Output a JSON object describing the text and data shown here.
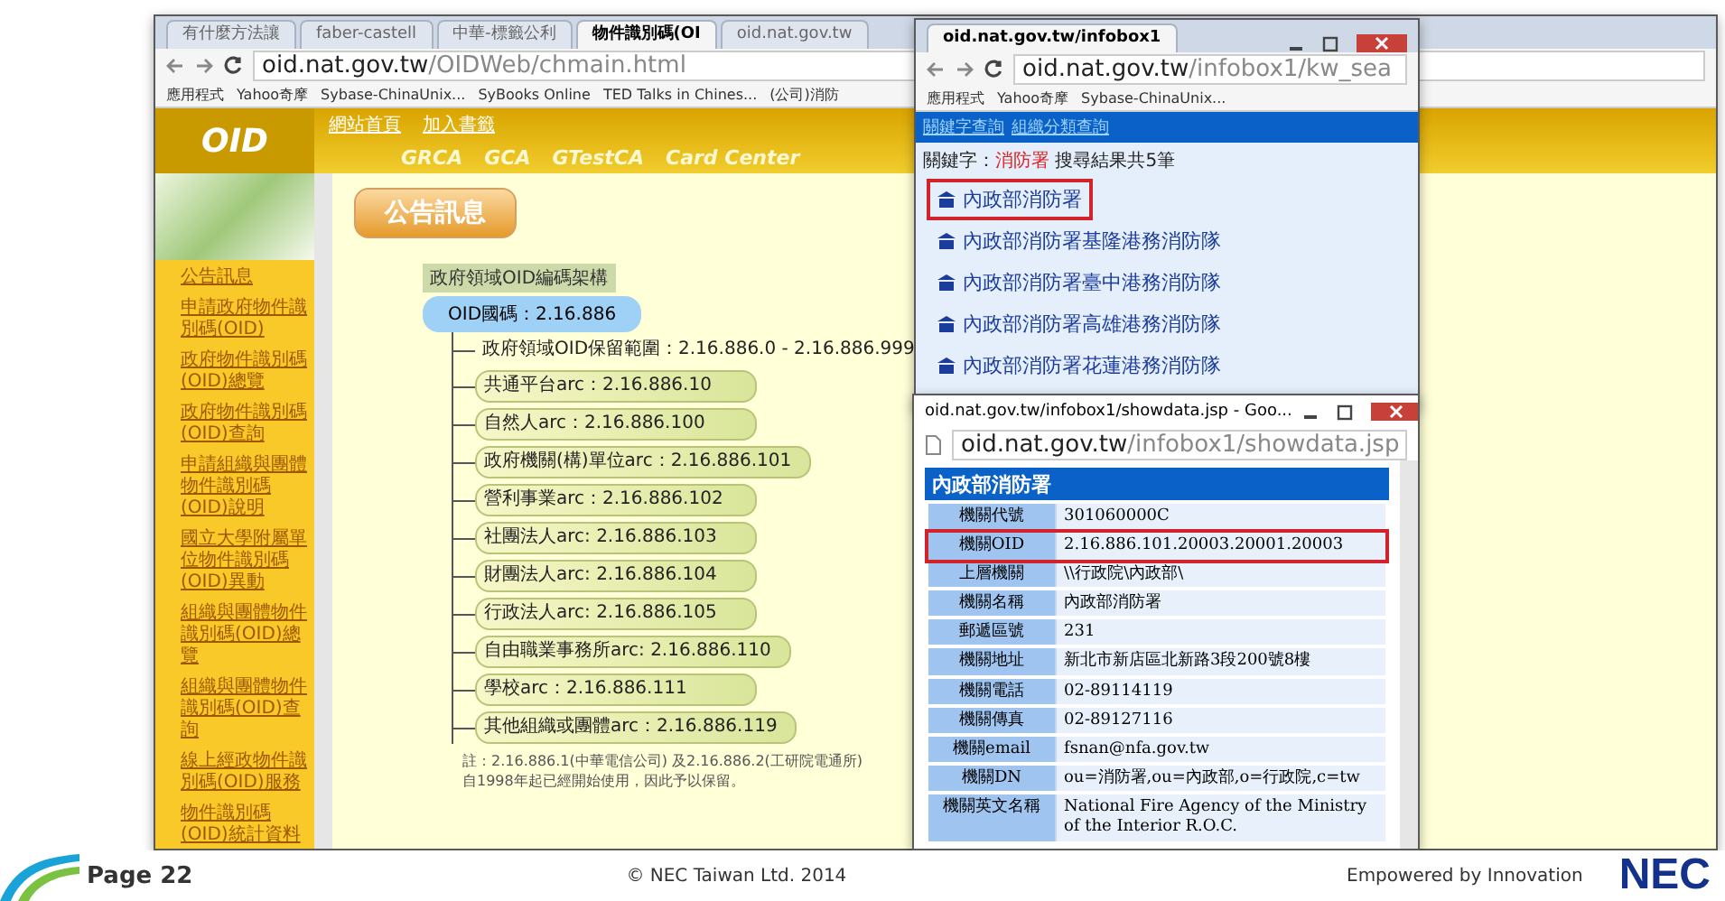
{
  "main_browser": {
    "tabs": [
      {
        "label": "有什麼方法讓",
        "selected": false
      },
      {
        "label": "faber-castell",
        "selected": false
      },
      {
        "label": "中華-標籤公利",
        "selected": false
      },
      {
        "label": "物件識別碼(OI",
        "selected": true
      },
      {
        "label": "oid.nat.gov.tw",
        "selected": false
      }
    ],
    "address": {
      "host": "oid.nat.gov.tw",
      "path": "/OIDWeb/chmain.html"
    },
    "bookmarks": [
      "應用程式",
      "Yahoo奇摩",
      "Sybase-ChinaUnix...",
      "SyBooks Online",
      "TED Talks in Chines...",
      "(公司)消防"
    ],
    "site": {
      "logo": "OID",
      "top_links": [
        "網站首頁",
        "加入書籤"
      ],
      "nav_links": [
        "GRCA",
        "GCA",
        "GTestCA",
        "Card Center"
      ],
      "sidebar": [
        "公告訊息",
        "申請政府物件識別碼(OID)",
        "政府物件識別碼(OID)總覽",
        "政府物件識別碼(OID)查詢",
        "申請組織與團體物件識別碼(OID)說明",
        "國立大學附屬單位物件識別碼(OID)異動",
        "組織與團體物件識別碼(OID)總覽",
        "組織與團體物件識別碼(OID)查詢",
        "線上經政物件識別碼(OID)服務",
        "物件識別碼(OID)統計資料"
      ],
      "banner": "公告訊息",
      "tree_caption": "政府領域OID編碼架構",
      "tree": {
        "label": "OID國碼：2.16.886",
        "children": [
          {
            "kind": "range",
            "label": "政府領域OID保留範圍：2.16.886.0 - 2.16.886.999"
          },
          {
            "kind": "arc",
            "label": "共通平台arc：2.16.886.10"
          },
          {
            "kind": "arc",
            "label": "自然人arc：2.16.886.100"
          },
          {
            "kind": "arc",
            "label": "政府機關(構)單位arc：2.16.886.101"
          },
          {
            "kind": "arc",
            "label": "營利事業arc：2.16.886.102"
          },
          {
            "kind": "arc",
            "label": "社團法人arc: 2.16.886.103"
          },
          {
            "kind": "arc",
            "label": "財團法人arc: 2.16.886.104"
          },
          {
            "kind": "arc",
            "label": "行政法人arc: 2.16.886.105"
          },
          {
            "kind": "arc",
            "label": "自由職業事務所arc: 2.16.886.110"
          },
          {
            "kind": "arc",
            "label": "學校arc：2.16.886.111"
          },
          {
            "kind": "arc",
            "label": "其他組織或團體arc：2.16.886.119"
          }
        ]
      },
      "footnote": "註：2.16.886.1(中華電信公司) 及2.16.886.2(工研院電通所) 自1998年起已經開始使用，因此予以保留。"
    }
  },
  "search_popup": {
    "tab": "oid.nat.gov.tw/infobox1",
    "address": {
      "host": "oid.nat.gov.tw",
      "path": "/infobox1/kw_sea"
    },
    "bookmarks": [
      "應用程式",
      "Yahoo奇摩",
      "Sybase-ChinaUnix..."
    ],
    "links": [
      "關鍵字查詢",
      "組織分類查詢"
    ],
    "keyword_label": "關鍵字：",
    "keyword": "消防署",
    "result_count": "搜尋結果共5筆",
    "results": [
      {
        "label": "內政部消防署",
        "highlighted": true
      },
      {
        "label": "內政部消防署基隆港務消防隊",
        "highlighted": false
      },
      {
        "label": "內政部消防署臺中港務消防隊",
        "highlighted": false
      },
      {
        "label": "內政部消防署高雄港務消防隊",
        "highlighted": false
      },
      {
        "label": "內政部消防署花蓮港務消防隊",
        "highlighted": false
      }
    ]
  },
  "detail_popup": {
    "title": "oid.nat.gov.tw/infobox1/showdata.jsp - Goo...",
    "address": {
      "host": "oid.nat.gov.tw",
      "path": "/infobox1/showdata.jsp"
    },
    "heading": "內政部消防署",
    "rows": [
      {
        "field": "機關代號",
        "value": "301060000C",
        "highlighted": false
      },
      {
        "field": "機關OID",
        "value": "2.16.886.101.20003.20001.20003",
        "highlighted": true
      },
      {
        "field": "上層機關",
        "value": "\\\\行政院\\內政部\\",
        "highlighted": false
      },
      {
        "field": "機關名稱",
        "value": "內政部消防署",
        "highlighted": false
      },
      {
        "field": "郵遞區號",
        "value": "231",
        "highlighted": false
      },
      {
        "field": "機關地址",
        "value": "新北市新店區北新路3段200號8樓",
        "highlighted": false
      },
      {
        "field": "機關電話",
        "value": "02-89114119",
        "highlighted": false
      },
      {
        "field": "機關傳真",
        "value": "02-89127116",
        "highlighted": false
      },
      {
        "field": "機關email",
        "value": "fsnan@nfa.gov.tw",
        "highlighted": false
      },
      {
        "field": "機關DN",
        "value": "ou=消防署,ou=內政部,o=行政院,c=tw",
        "highlighted": false
      },
      {
        "field": "機關英文名稱",
        "value": "National Fire Agency of the Ministry of the Interior R.O.C.",
        "highlighted": false
      }
    ]
  },
  "footer": {
    "page": "Page 22",
    "copyright": "© NEC Taiwan Ltd. 2014",
    "tagline": "Empowered by Innovation",
    "logo": "NEC"
  }
}
